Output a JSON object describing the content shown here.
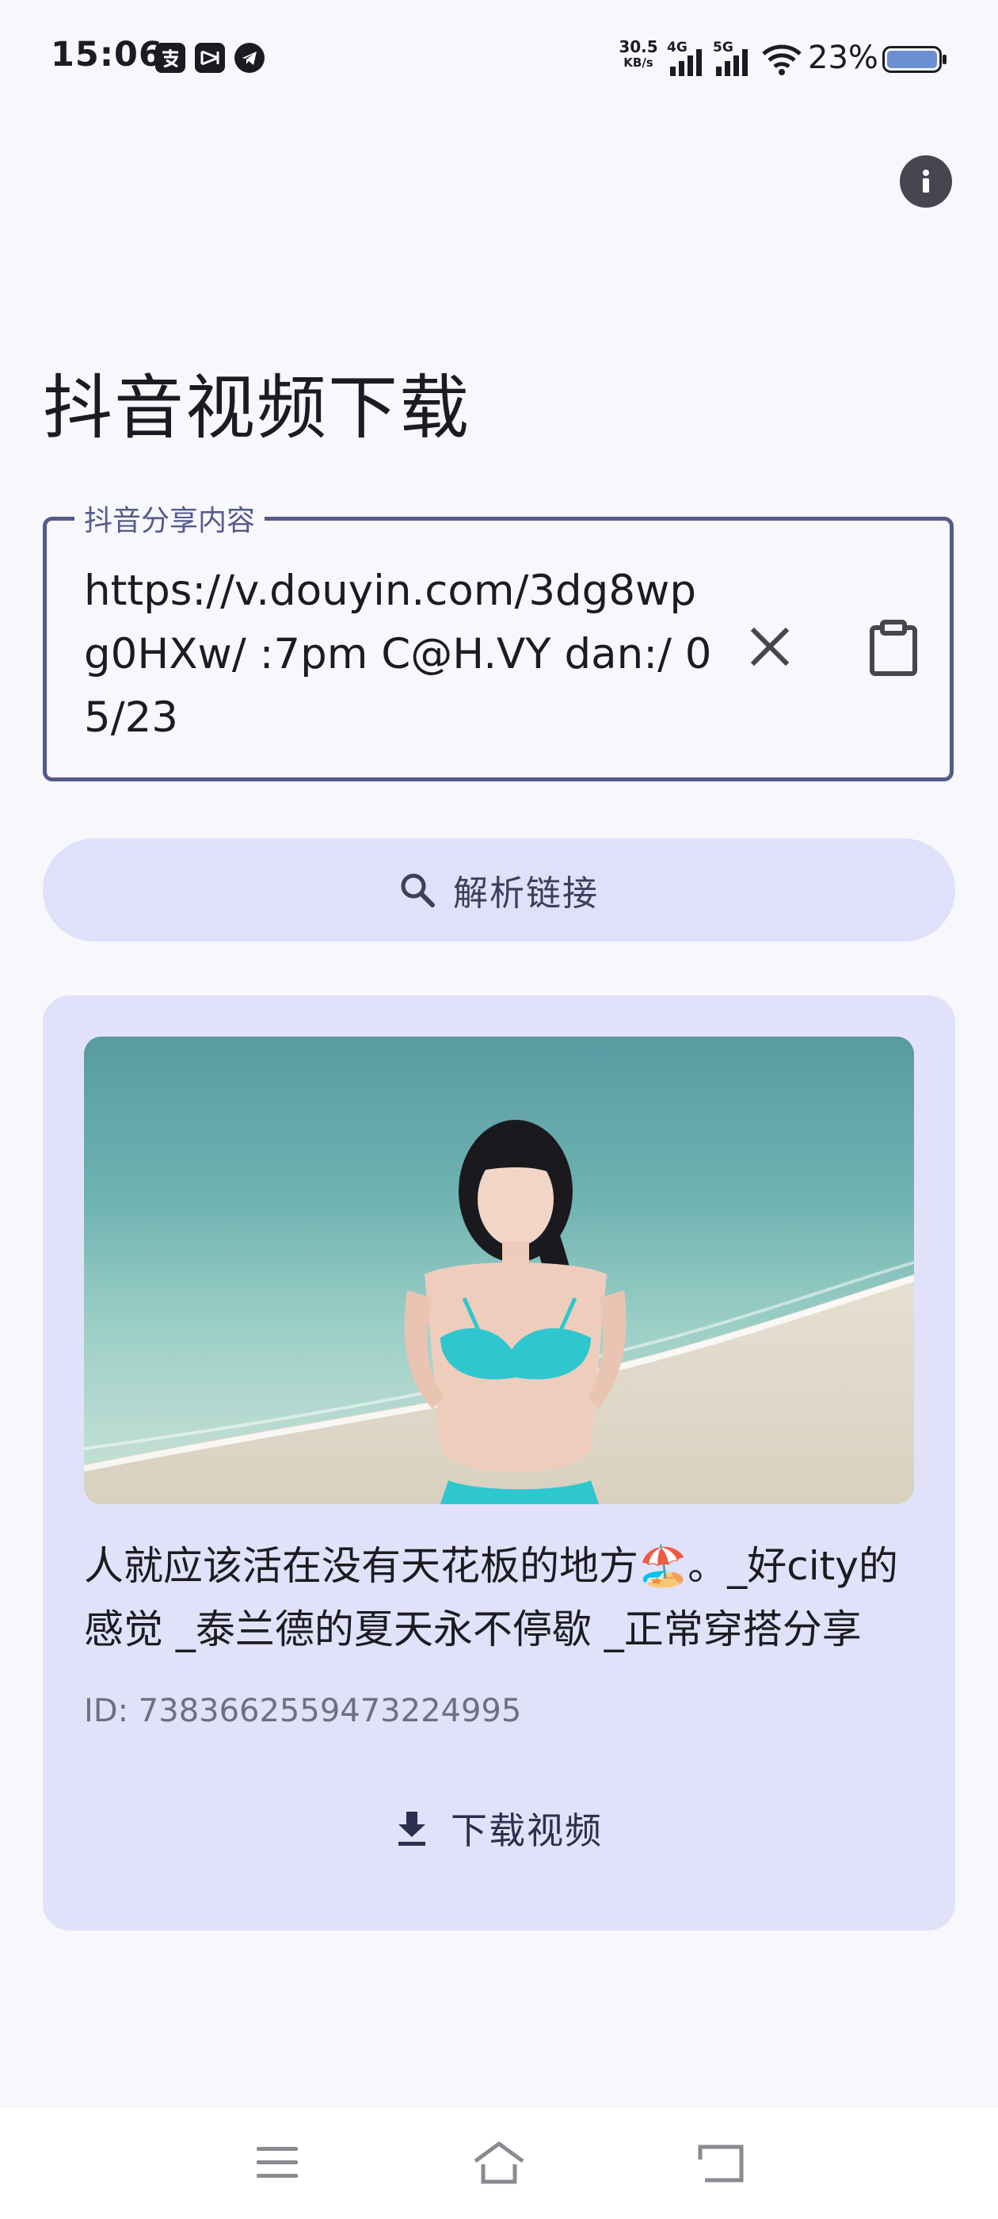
{
  "status_bar": {
    "time": "15:06",
    "notification_icons": [
      "alipay-icon",
      "capcut-icon",
      "telegram-icon"
    ],
    "net_speed_value": "30.5",
    "net_speed_unit": "KB/s",
    "signal_1_label": "4G",
    "signal_2_label": "5G",
    "battery_percent": "23%"
  },
  "header": {
    "info_icon": "info-icon"
  },
  "page": {
    "title": "抖音视频下载"
  },
  "share_field": {
    "label": "抖音分享内容",
    "value": "https://v.douyin.com/3dg8wpg0HXw/ :7pm C@H.VY dan:/ 05/23",
    "clear_icon": "close-icon",
    "paste_icon": "clipboard-icon"
  },
  "parse_button": {
    "label": "解析链接",
    "icon": "search-icon"
  },
  "result": {
    "thumbnail_alt": "beach-photo",
    "title": "人就应该活在没有天花板的地方🏖️。_好city的感觉 _泰兰德的夏天永不停歇 _正常穿搭分享",
    "id_text": "ID: 7383662559473224995",
    "download_label": "下载视频",
    "download_icon": "download-icon"
  },
  "nav_bar": {
    "menu_icon": "menu-icon",
    "home_icon": "home-icon",
    "back_icon": "back-icon"
  },
  "colors": {
    "background": "#f7f7fc",
    "primary_outline": "#545a8b",
    "button_container": "#dfe0f9",
    "card_container": "#e1e2f9"
  }
}
